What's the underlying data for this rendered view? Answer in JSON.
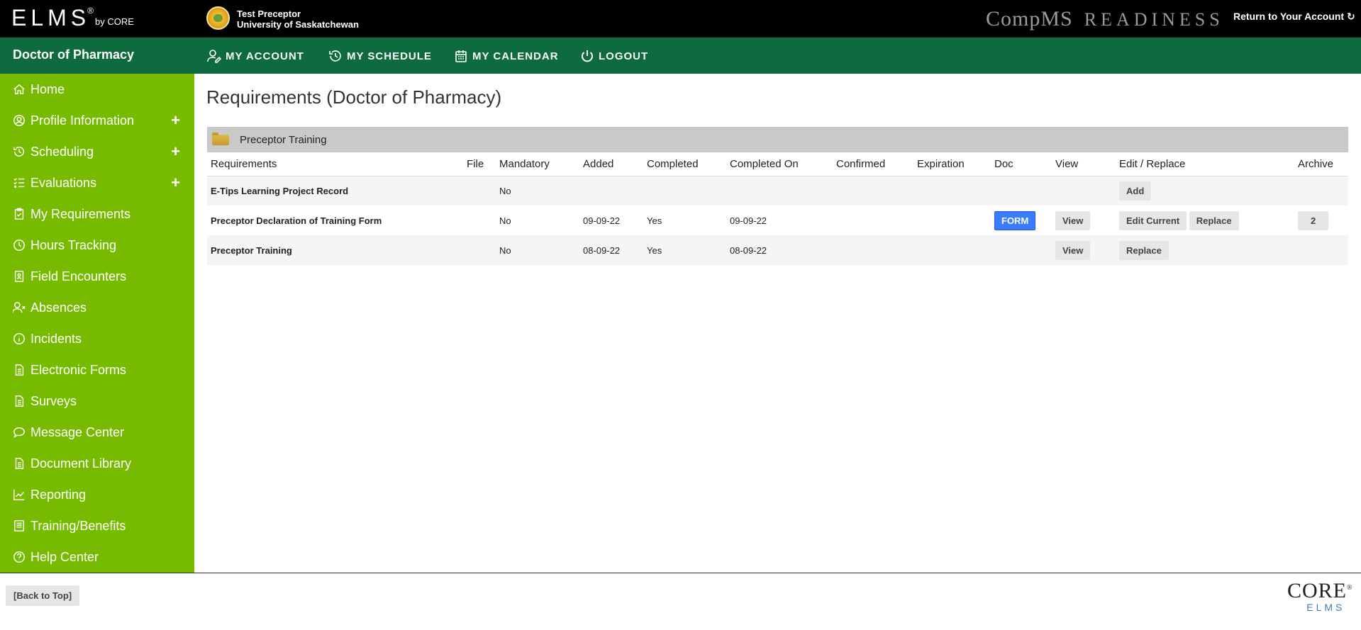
{
  "topbar": {
    "logo": "ELMS",
    "logo_reg": "®",
    "logo_by": "by CORE",
    "user_name": "Test Preceptor",
    "user_org": "University of Saskatchewan",
    "brand_left": "CompMS",
    "brand_right": "READINESS",
    "return_link": "Return to Your Account"
  },
  "navbar": {
    "program": "Doctor of Pharmacy",
    "items": [
      {
        "label": "MY ACCOUNT",
        "icon": "user-edit-icon"
      },
      {
        "label": "MY SCHEDULE",
        "icon": "history-icon"
      },
      {
        "label": "MY CALENDAR",
        "icon": "calendar-icon"
      },
      {
        "label": "LOGOUT",
        "icon": "power-icon"
      }
    ]
  },
  "sidebar": {
    "items": [
      {
        "label": "Home",
        "icon": "home-icon",
        "expandable": false
      },
      {
        "label": "Profile Information",
        "icon": "user-circle-icon",
        "expandable": true
      },
      {
        "label": "Scheduling",
        "icon": "history-icon",
        "expandable": true
      },
      {
        "label": "Evaluations",
        "icon": "list-check-icon",
        "expandable": true
      },
      {
        "label": "My Requirements",
        "icon": "clipboard-check-icon",
        "expandable": false
      },
      {
        "label": "Hours Tracking",
        "icon": "clock-icon",
        "expandable": false
      },
      {
        "label": "Field Encounters",
        "icon": "id-badge-icon",
        "expandable": false
      },
      {
        "label": "Absences",
        "icon": "user-x-icon",
        "expandable": false
      },
      {
        "label": "Incidents",
        "icon": "info-icon",
        "expandable": false
      },
      {
        "label": "Electronic Forms",
        "icon": "file-icon",
        "expandable": false
      },
      {
        "label": "Surveys",
        "icon": "file-icon",
        "expandable": false
      },
      {
        "label": "Message Center",
        "icon": "chat-icon",
        "expandable": false
      },
      {
        "label": "Document Library",
        "icon": "file-icon",
        "expandable": false
      },
      {
        "label": "Reporting",
        "icon": "chart-line-icon",
        "expandable": false
      },
      {
        "label": "Training/Benefits",
        "icon": "book-icon",
        "expandable": false
      },
      {
        "label": "Help Center",
        "icon": "question-icon",
        "expandable": false
      }
    ],
    "plus": "+"
  },
  "main": {
    "title": "Requirements (Doctor of Pharmacy)",
    "section": "Preceptor Training",
    "columns": [
      "Requirements",
      "File",
      "Mandatory",
      "Added",
      "Completed",
      "Completed On",
      "Confirmed",
      "Expiration",
      "Doc",
      "View",
      "Edit / Replace",
      "Archive"
    ],
    "rows": [
      {
        "name": "E-Tips Learning Project Record",
        "file": "",
        "mandatory": "No",
        "added": "",
        "completed": "",
        "completed_on": "",
        "confirmed": "",
        "expiration": "",
        "doc": "",
        "view": "",
        "edit": [
          "Add"
        ],
        "archive": ""
      },
      {
        "name": "Preceptor Declaration of Training Form",
        "file": "",
        "mandatory": "No",
        "added": "09-09-22",
        "completed": "Yes",
        "completed_on": "09-09-22",
        "confirmed": "",
        "expiration": "",
        "doc": "FORM",
        "view": "View",
        "edit": [
          "Edit Current",
          "Replace"
        ],
        "archive": "2"
      },
      {
        "name": "Preceptor Training",
        "file": "",
        "mandatory": "No",
        "added": "08-09-22",
        "completed": "Yes",
        "completed_on": "08-09-22",
        "confirmed": "",
        "expiration": "",
        "doc": "",
        "view": "View",
        "edit": [
          "Replace"
        ],
        "archive": ""
      }
    ]
  },
  "footer": {
    "back_to_top": "[Back to Top]",
    "core_logo": "CORE",
    "core_reg": "®",
    "core_sub": "ELMS"
  },
  "colors": {
    "topbar": "#000000",
    "navbar": "#0e6a3f",
    "sidebar": "#77bb00",
    "form_button": "#3a7bff"
  }
}
